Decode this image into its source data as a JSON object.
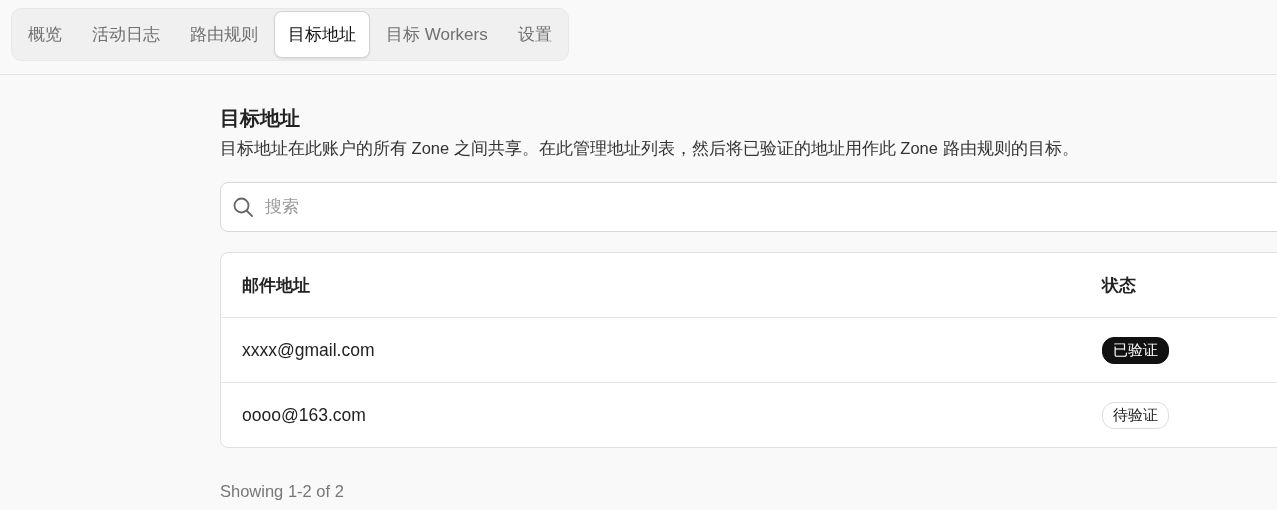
{
  "tabs": [
    {
      "label": "概览",
      "selected": false
    },
    {
      "label": "活动日志",
      "selected": false
    },
    {
      "label": "路由规则",
      "selected": false
    },
    {
      "label": "目标地址",
      "selected": true
    },
    {
      "label": "目标 Workers",
      "selected": false
    },
    {
      "label": "设置",
      "selected": false
    }
  ],
  "section": {
    "title": "目标地址",
    "description": "目标地址在此账户的所有 Zone 之间共享。在此管理地址列表，然后将已验证的地址用作此 Zone 路由规则的目标。"
  },
  "search": {
    "placeholder": "搜索"
  },
  "table": {
    "columns": [
      "邮件地址",
      "状态"
    ],
    "rows": [
      {
        "email": "xxxx@gmail.com",
        "status": {
          "label": "已验证",
          "kind": "verified"
        }
      },
      {
        "email": "oooo@163.com",
        "status": {
          "label": "待验证",
          "kind": "pending"
        }
      }
    ]
  },
  "footer": "Showing 1-2 of 2"
}
